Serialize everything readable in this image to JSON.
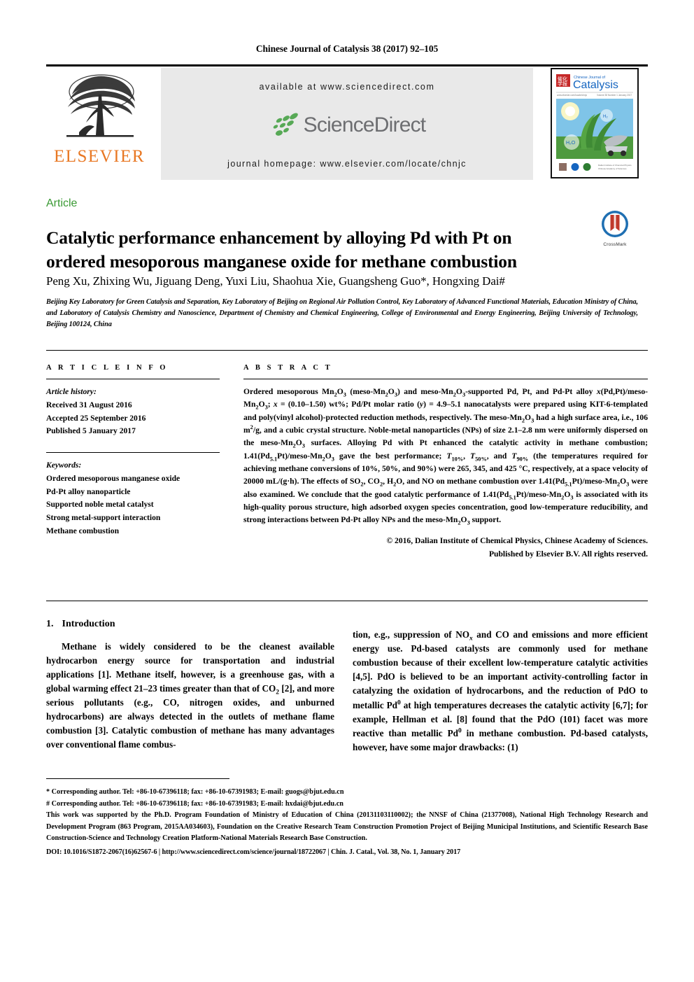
{
  "running_head": "Chinese Journal of Catalysis 38 (2017) 92–105",
  "masthead": {
    "publisher_name": "ELSEVIER",
    "available_at": "available at www.sciencedirect.com",
    "sciencedirect_wordmark": "ScienceDirect",
    "journal_homepage": "journal homepage: www.elsevier.com/locate/chnjc",
    "cover_title_small": "Chinese Journal of",
    "cover_title_big": "Catalysis",
    "cover_label_h2": "H₂",
    "cover_label_h2o": "H₂O"
  },
  "article": {
    "type_label": "Article",
    "title_line1": "Catalytic performance enhancement by alloying Pd with Pt on",
    "title_line2": "ordered mesoporous manganese oxide for methane combustion",
    "crossmark_label": "CrossMark",
    "authors": "Peng Xu, Zhixing Wu, Jiguang Deng, Yuxi Liu, Shaohua Xie, Guangsheng Guo*, Hongxing Dai#",
    "affiliation": "Beijing Key Laboratory for Green Catalysis and Separation, Key Laboratory of Beijing on Regional Air Pollution Control, Key Laboratory of Advanced Functional Materials, Education Ministry of China, and Laboratory of Catalysis Chemistry and Nanoscience, Department of Chemistry and Chemical Engineering, College of Environmental and Energy Engineering, Beijing University of Technology, Beijing 100124, China"
  },
  "article_info": {
    "heading": "A R T I C L E    I N F O",
    "history_label": "Article history:",
    "received": "Received 31 August 2016",
    "accepted": "Accepted 25 September 2016",
    "published": "Published 5 January 2017",
    "keywords_label": "Keywords:",
    "keywords": [
      "Ordered mesoporous manganese oxide",
      "Pd-Pt alloy nanoparticle",
      "Supported noble metal catalyst",
      "Strong metal-support interaction",
      "Methane combustion"
    ]
  },
  "abstract": {
    "heading": "A B S T R A C T",
    "copyright_line1": "© 2016, Dalian Institute of Chemical Physics, Chinese Academy of Sciences.",
    "copyright_line2": "Published by Elsevier B.V. All rights reserved."
  },
  "introduction": {
    "number": "1.",
    "title": "Introduction"
  },
  "footnotes": {
    "note1": "* Corresponding author. Tel: +86-10-67396118; fax: +86-10-67391983; E-mail: guogs@bjut.edu.cn",
    "note2": "# Corresponding author. Tel: +86-10-67396118; fax: +86-10-67391983; E-mail: hxdai@bjut.edu.cn",
    "funding": "This work was supported by the Ph.D. Program Foundation of Ministry of Education of China (20131103110002); the NNSF of China (21377008), National High Technology Research and Development Program (863 Program, 2015AA034603), Foundation on the Creative Research Team Construction Promotion Project of Beijing Municipal Institutions, and Scientific Research Base Construction-Science and Technology Creation Platform-National Materials Research Base Construction.",
    "doi_line": "DOI: 10.1016/S1872-2067(16)62567-6 | http://www.sciencedirect.com/science/journal/18722067 | Chin. J. Catal., Vol. 38, No. 1, January 2017"
  },
  "colors": {
    "elsevier_orange": "#E87722",
    "article_green": "#3a9a34",
    "sciencedirect_gray": "#6d6e71",
    "sciencedirect_green": "#4caf50",
    "banner_gray": "#e9e9e9"
  }
}
